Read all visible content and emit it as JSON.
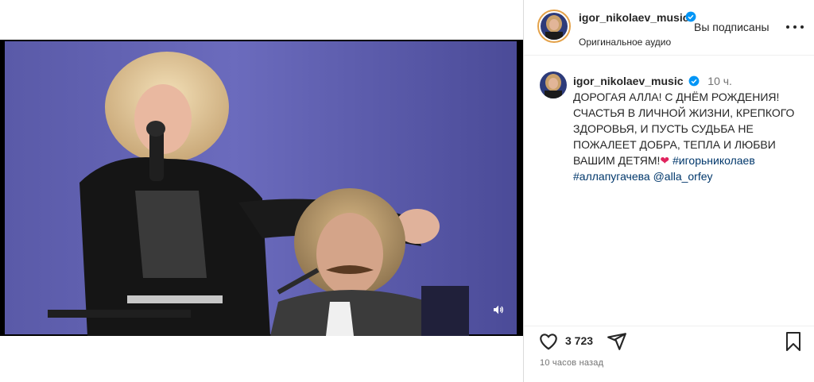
{
  "media": {
    "icon_mute": "volume-icon"
  },
  "header": {
    "username": "igor_nikolaev_music",
    "subtitle": "Оригинальное аудио",
    "following_label": "Вы подписаны",
    "more_icon": "more-horizontal-icon"
  },
  "caption": {
    "username": "igor_nikolaev_music",
    "time": "10 ч.",
    "text": "ДОРОГАЯ АЛЛА! С ДНЁМ РОЖДЕНИЯ! СЧАСТЬЯ В ЛИЧНОЙ ЖИЗНИ, КРЕПКОГО ЗДОРОВЬЯ, И ПУСТЬ СУДЬБА НЕ ПОЖАЛЕЕТ ДОБРА, ТЕПЛА И ЛЮБВИ ВАШИМ ДЕТЯМ!",
    "emoji": "❤",
    "hashtag_1": "#игорьниколаев",
    "hashtag_2": "#аллапугачева",
    "mention": "@alla_orfey"
  },
  "actions": {
    "like_count": "3 723",
    "like_icon": "heart-icon",
    "share_icon": "send-icon",
    "save_icon": "bookmark-icon"
  },
  "footer": {
    "post_time": "10 часов назад"
  },
  "colors": {
    "verified": "#0095f6",
    "link": "#00376b",
    "muted": "#737373",
    "heart": "#e0245e"
  }
}
